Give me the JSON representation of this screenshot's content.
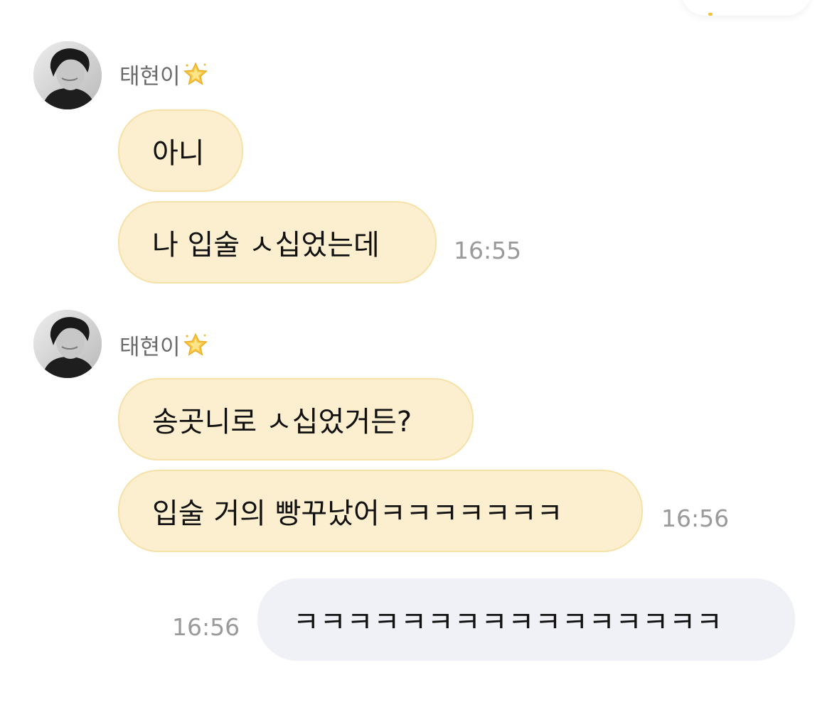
{
  "messages": [
    {
      "sender": "태현이",
      "sender_badge_icon": "sparkle-star-icon",
      "bubbles": [
        "아니",
        "나 입술 ㅅ십었는데"
      ],
      "time": "16:55"
    },
    {
      "sender": "태현이",
      "sender_badge_icon": "sparkle-star-icon",
      "bubbles": [
        "송곳니로 ㅅ십었거든?",
        "입술 거의 빵꾸났어ㅋㅋㅋㅋㅋㅋㅋ"
      ],
      "time": "16:56"
    }
  ],
  "my_message": {
    "text": "ㅋㅋㅋㅋㅋㅋㅋㅋㅋㅋㅋㅋㅋㅋㅋㅋ",
    "time": "16:56"
  },
  "colors": {
    "incoming_bubble": "#fcefcf",
    "incoming_border": "#f6e1a8",
    "outgoing_bubble": "#f0f1f6",
    "timestamp": "#9a9a9a",
    "sender_name": "#6a6a6a"
  }
}
